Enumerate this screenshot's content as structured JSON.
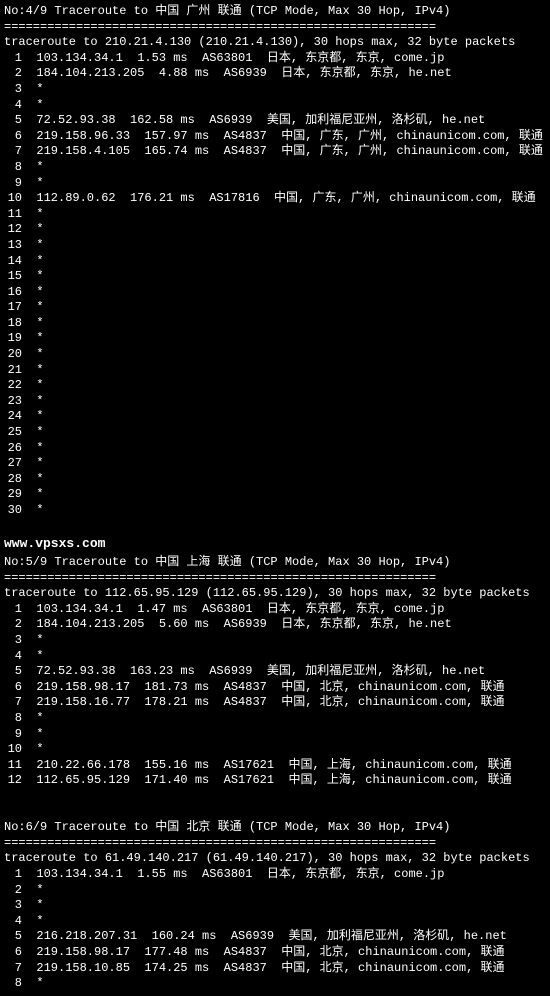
{
  "traces": [
    {
      "header": "No:4/9 Traceroute to 中国 广州 联通 (TCP Mode, Max 30 Hop, IPv4)",
      "divider": "============================================================",
      "summary": "traceroute to 210.21.4.130 (210.21.4.130), 30 hops max, 32 byte packets",
      "hops": [
        {
          "n": "1",
          "body": "103.134.34.1  1.53 ms  AS63801  日本, 东京都, 东京, come.jp"
        },
        {
          "n": "2",
          "body": "184.104.213.205  4.88 ms  AS6939  日本, 东京都, 东京, he.net"
        },
        {
          "n": "3",
          "body": "*"
        },
        {
          "n": "4",
          "body": "*"
        },
        {
          "n": "5",
          "body": "72.52.93.38  162.58 ms  AS6939  美国, 加利福尼亚州, 洛杉矶, he.net"
        },
        {
          "n": "6",
          "body": "219.158.96.33  157.97 ms  AS4837  中国, 广东, 广州, chinaunicom.com, 联通"
        },
        {
          "n": "7",
          "body": "219.158.4.105  165.74 ms  AS4837  中国, 广东, 广州, chinaunicom.com, 联通"
        },
        {
          "n": "8",
          "body": "*"
        },
        {
          "n": "9",
          "body": "*"
        },
        {
          "n": "10",
          "body": "112.89.0.62  176.21 ms  AS17816  中国, 广东, 广州, chinaunicom.com, 联通"
        },
        {
          "n": "11",
          "body": "*"
        },
        {
          "n": "12",
          "body": "*"
        },
        {
          "n": "13",
          "body": "*"
        },
        {
          "n": "14",
          "body": "*"
        },
        {
          "n": "15",
          "body": "*"
        },
        {
          "n": "16",
          "body": "*"
        },
        {
          "n": "17",
          "body": "*"
        },
        {
          "n": "18",
          "body": "*"
        },
        {
          "n": "19",
          "body": "*"
        },
        {
          "n": "20",
          "body": "*"
        },
        {
          "n": "21",
          "body": "*"
        },
        {
          "n": "22",
          "body": "*"
        },
        {
          "n": "23",
          "body": "*"
        },
        {
          "n": "24",
          "body": "*"
        },
        {
          "n": "25",
          "body": "*"
        },
        {
          "n": "26",
          "body": "*"
        },
        {
          "n": "27",
          "body": "*"
        },
        {
          "n": "28",
          "body": "*"
        },
        {
          "n": "29",
          "body": "*"
        },
        {
          "n": "30",
          "body": "*"
        }
      ],
      "trailing_blank": true
    },
    {
      "header": "No:5/9 Traceroute to 中国 上海 联通 (TCP Mode, Max 30 Hop, IPv4)",
      "divider": "============================================================",
      "summary": "traceroute to 112.65.95.129 (112.65.95.129), 30 hops max, 32 byte packets",
      "hops": [
        {
          "n": "1",
          "body": "103.134.34.1  1.47 ms  AS63801  日本, 东京都, 东京, come.jp"
        },
        {
          "n": "2",
          "body": "184.104.213.205  5.60 ms  AS6939  日本, 东京都, 东京, he.net"
        },
        {
          "n": "3",
          "body": "*"
        },
        {
          "n": "4",
          "body": "*"
        },
        {
          "n": "5",
          "body": "72.52.93.38  163.23 ms  AS6939  美国, 加利福尼亚州, 洛杉矶, he.net"
        },
        {
          "n": "6",
          "body": "219.158.98.17  181.73 ms  AS4837  中国, 北京, chinaunicom.com, 联通"
        },
        {
          "n": "7",
          "body": "219.158.16.77  178.21 ms  AS4837  中国, 北京, chinaunicom.com, 联通"
        },
        {
          "n": "8",
          "body": "*"
        },
        {
          "n": "9",
          "body": "*"
        },
        {
          "n": "10",
          "body": "*"
        },
        {
          "n": "11",
          "body": "210.22.66.178  155.16 ms  AS17621  中国, 上海, chinaunicom.com, 联通"
        },
        {
          "n": "12",
          "body": "112.65.95.129  171.40 ms  AS17621  中国, 上海, chinaunicom.com, 联通"
        }
      ],
      "trailing_blank": true,
      "trailing_blank2": true
    },
    {
      "header": "No:6/9 Traceroute to 中国 北京 联通 (TCP Mode, Max 30 Hop, IPv4)",
      "divider": "============================================================",
      "summary": "traceroute to 61.49.140.217 (61.49.140.217), 30 hops max, 32 byte packets",
      "hops": [
        {
          "n": "1",
          "body": "103.134.34.1  1.55 ms  AS63801  日本, 东京都, 东京, come.jp"
        },
        {
          "n": "2",
          "body": "*"
        },
        {
          "n": "3",
          "body": "*"
        },
        {
          "n": "4",
          "body": "*"
        },
        {
          "n": "5",
          "body": "216.218.207.31  160.24 ms  AS6939  美国, 加利福尼亚州, 洛杉矶, he.net"
        },
        {
          "n": "6",
          "body": "219.158.98.17  177.48 ms  AS4837  中国, 北京, chinaunicom.com, 联通"
        },
        {
          "n": "7",
          "body": "219.158.10.85  174.25 ms  AS4837  中国, 北京, chinaunicom.com, 联通"
        },
        {
          "n": "8",
          "body": "*"
        }
      ]
    }
  ],
  "watermark": "www.vpsxs.com",
  "watermark_after_trace_index": 0
}
